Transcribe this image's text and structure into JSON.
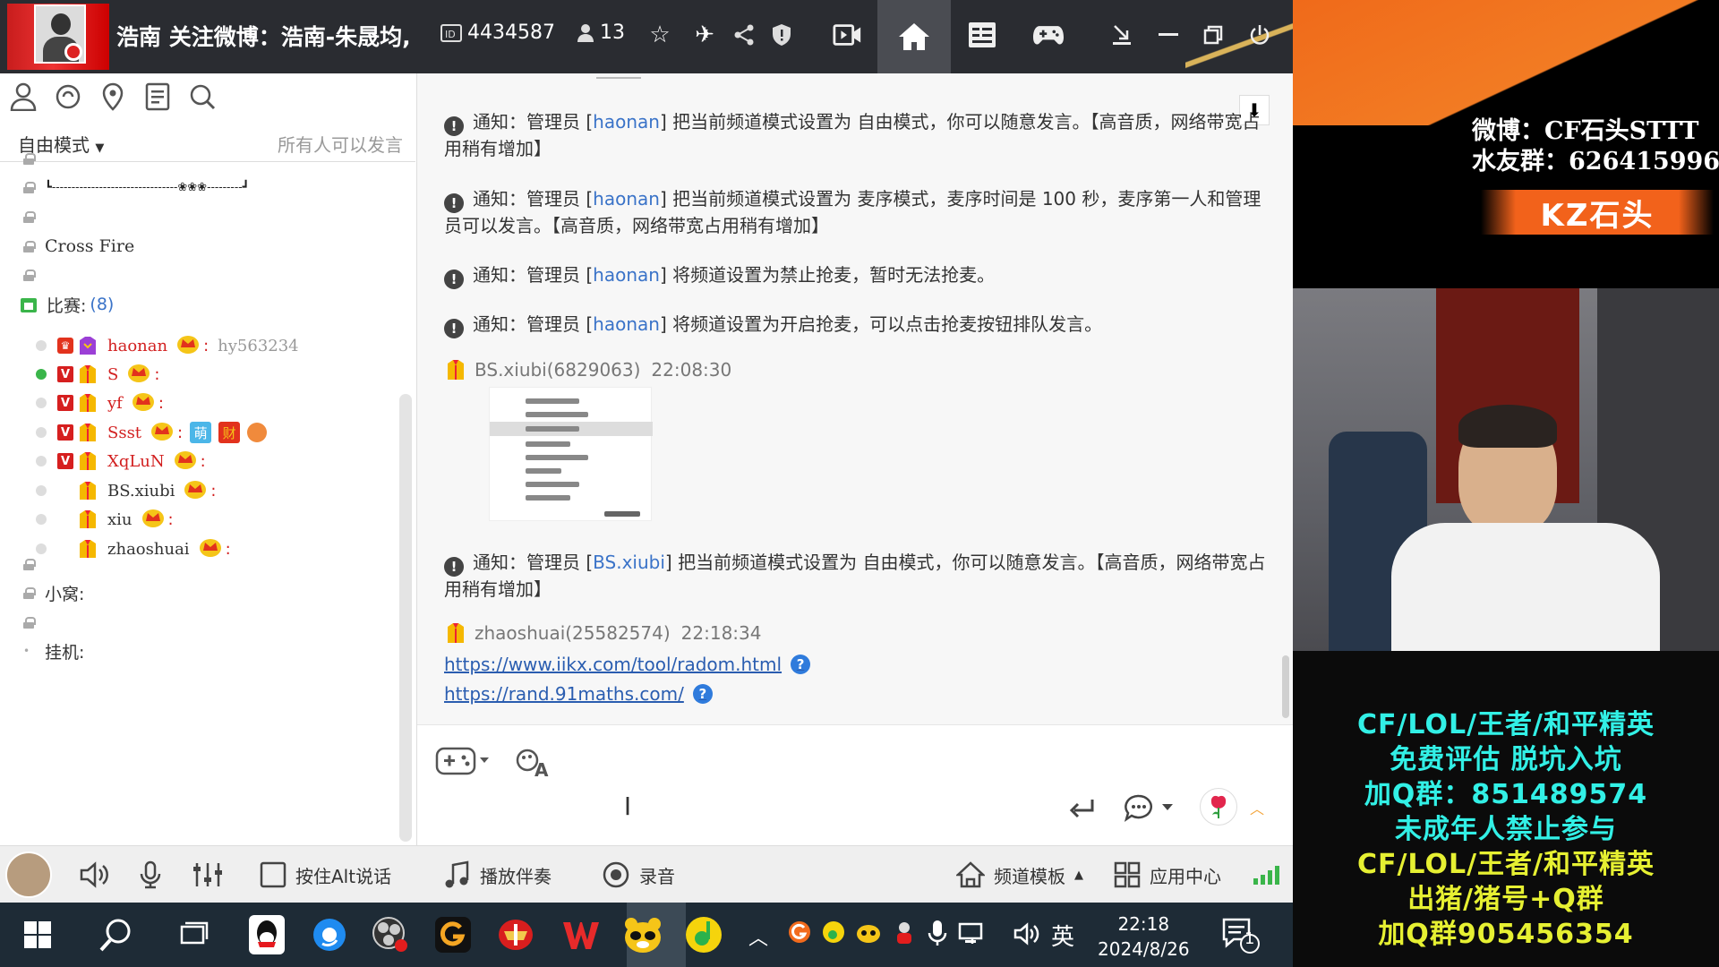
{
  "titlebar": {
    "title": "浩南 关注微博：浩南-朱晟均,",
    "channel_id": "4434587",
    "online_count": "13"
  },
  "left": {
    "mode": "自由模式",
    "mode_hint": "所有人可以发言",
    "channels": {
      "divider_text": "┗--------------------------------❀❀❀---------┛",
      "cross_fire": "Cross Fire",
      "match": "比赛:",
      "match_count": "(8)",
      "xiaowo": "小窝:",
      "guaji": "挂机:"
    },
    "users": [
      {
        "name": "haonan",
        "id": "hy563234",
        "online": false
      },
      {
        "name": "S",
        "online": true
      },
      {
        "name": "yf",
        "online": false
      },
      {
        "name": "Ssst",
        "online": false,
        "badge1": "萌",
        "badge2": "财"
      },
      {
        "name": "XqLuN",
        "online": false
      },
      {
        "name": "BS.xiubi",
        "online": false
      },
      {
        "name": "xiu",
        "online": false
      },
      {
        "name": "zhaoshuai",
        "online": false
      }
    ]
  },
  "chat": {
    "messages": [
      {
        "prefix": "通知：管理员 [",
        "admin": "haonan",
        "text": "] 把当前频道模式设置为 自由模式，你可以随意发言。【高音质，网络带宽占用稍有增加】"
      },
      {
        "prefix": "通知：管理员 [",
        "admin": "haonan",
        "text": "] 把当前频道模式设置为 麦序模式，麦序时间是 100 秒，麦序第一人和管理员可以发言。【高音质，网络带宽占用稍有增加】"
      },
      {
        "prefix": "通知：管理员 [",
        "admin": "haonan",
        "text": "] 将频道设置为禁止抢麦，暂时无法抢麦。"
      },
      {
        "prefix": "通知：管理员 [",
        "admin": "haonan",
        "text": "] 将频道设置为开启抢麦，可以点击抢麦按钮排队发言。"
      },
      {
        "prefix": "通知：管理员 [",
        "admin": "BS.xiubi",
        "text": "] 把当前频道模式设置为 自由模式，你可以随意发言。【高音质，网络带宽占用稍有增加】"
      }
    ],
    "sender1": {
      "name": "BS.xiubi(6829063)",
      "time": "22:08:30"
    },
    "sender2": {
      "name": "zhaoshuai(25582574)",
      "time": "22:18:34"
    },
    "link1": "https://www.iikx.com/tool/radom.html",
    "link2": "https://rand.91maths.com/"
  },
  "bottombar": {
    "alt_talk": "按住Alt说话",
    "accompany": "播放伴奏",
    "record": "录音",
    "template": "频道模板",
    "app_center": "应用中心"
  },
  "taskbar": {
    "ime": "英",
    "time": "22:18",
    "date": "2024/8/26",
    "notif_count": "1"
  },
  "overlay": {
    "weibo_line": "微博：CF石头STTT",
    "group_line": "水友群：626415996",
    "brand": "KZ石头",
    "promo": [
      {
        "text": "CF/LOL/王者/和平精英",
        "color": "#32f0e6"
      },
      {
        "text": "免费评估  脱坑入坑",
        "color": "#32f0e6"
      },
      {
        "text": "加Q群：851489574",
        "color": "#32f0e6"
      },
      {
        "text": "未成年人禁止参与",
        "color": "#32f0e6"
      },
      {
        "text": "CF/LOL/王者/和平精英",
        "color": "#e6f032"
      },
      {
        "text": "出猪/猪号+Q群",
        "color": "#e6f032"
      },
      {
        "text": "加Q群905456354",
        "color": "#e6f032"
      }
    ]
  },
  "colors": {
    "accent_orange": "#f2621b",
    "admin_blue": "#3a73c8",
    "user_red": "#d21f1f"
  }
}
